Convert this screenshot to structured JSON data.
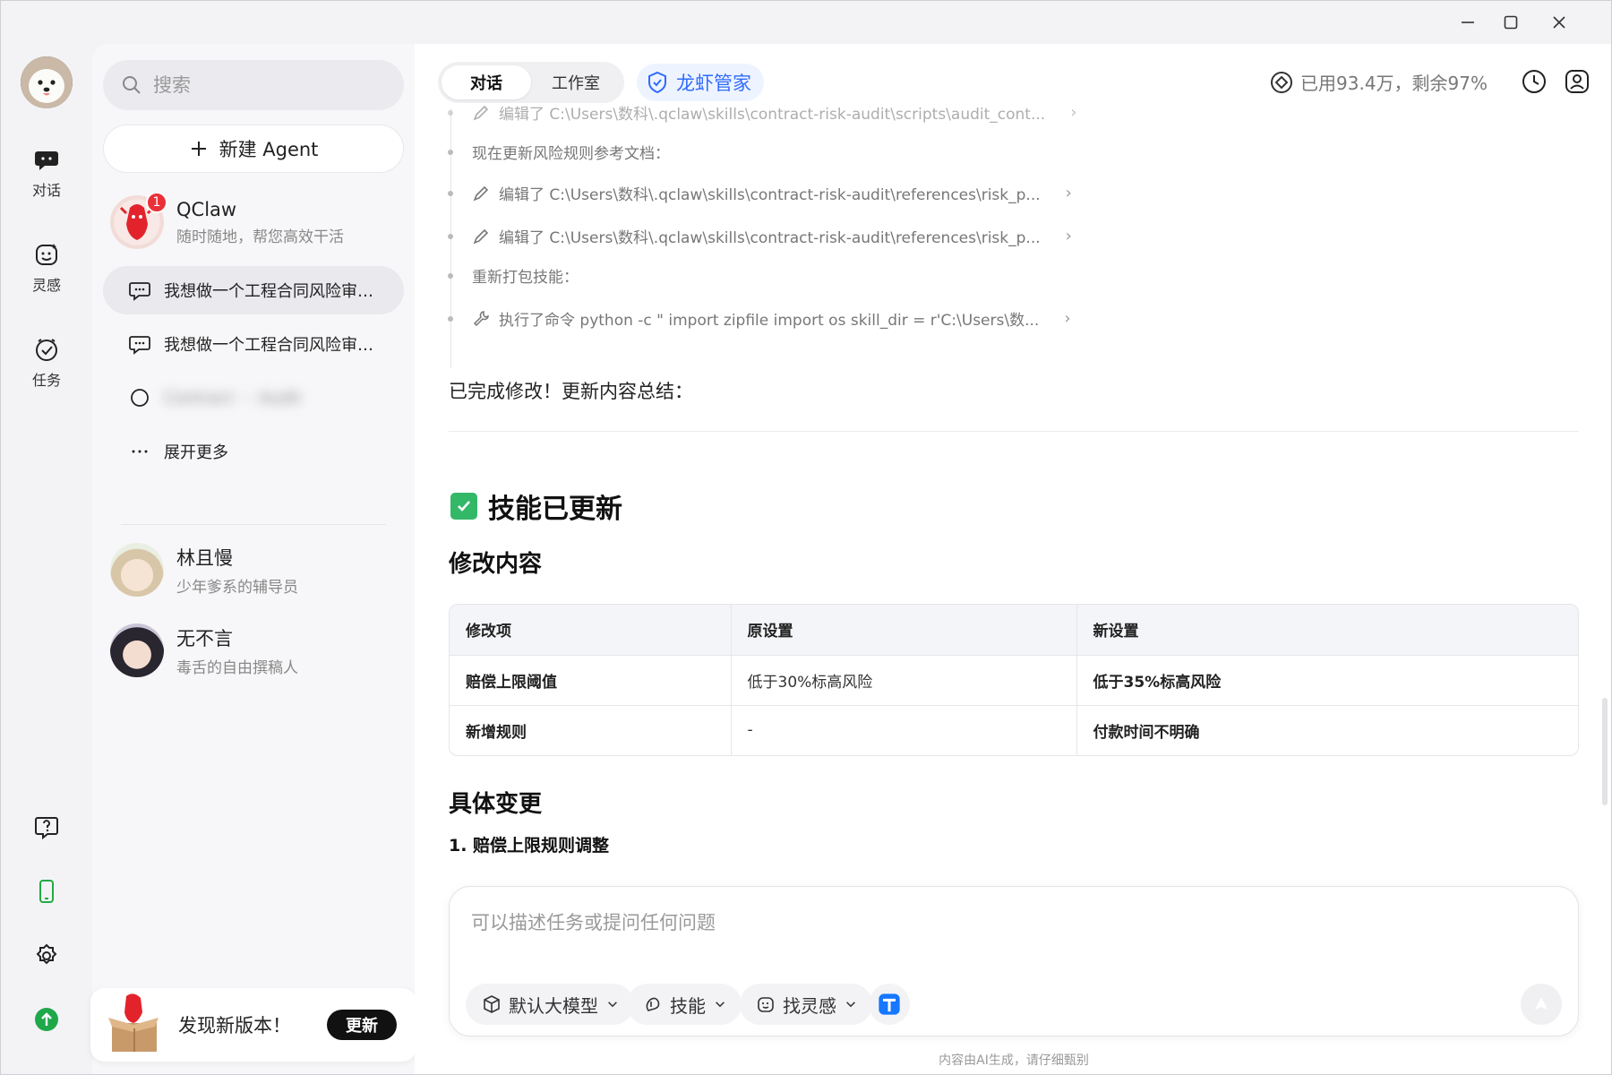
{
  "window": {
    "minimize": "minimize",
    "maximize": "maximize",
    "close": "close"
  },
  "rail": {
    "items": [
      {
        "label": "对话",
        "icon": "chat-bubble-icon"
      },
      {
        "label": "灵感",
        "icon": "inspiration-icon"
      },
      {
        "label": "任务",
        "icon": "task-check-icon"
      }
    ],
    "bottom_icons": [
      "help-icon",
      "phone-icon",
      "settings-icon",
      "upgrade-icon"
    ]
  },
  "sidebar": {
    "search_placeholder": "搜索",
    "new_agent_label": "新建 Agent",
    "agents": [
      {
        "name": "QClaw",
        "desc": "随时随地，帮您高效干活",
        "badge": "1"
      },
      {
        "name": "林且慢",
        "desc": "少年爹系的辅导员"
      },
      {
        "name": "无不言",
        "desc": "毒舌的自由撰稿人"
      }
    ],
    "chats": [
      {
        "title": "我想做一个工程合同风险审…"
      },
      {
        "title": "我想做一个工程合同风险审…"
      },
      {
        "title": "Contract ··· Audit"
      }
    ],
    "expand_more": "展开更多",
    "update": {
      "text": "发现新版本！",
      "button": "更新"
    }
  },
  "header": {
    "tabs": [
      "对话",
      "工作室"
    ],
    "manager_label": "龙虾管家",
    "usage_text": "已用93.4万，剩余97%"
  },
  "steps": [
    {
      "type": "action",
      "icon": "pencil-icon",
      "text": "编辑了 C:\\Users\\数科\\.qclaw\\skills\\contract-risk-audit\\scripts\\audit_cont..."
    },
    {
      "type": "note",
      "text": "现在更新风险规则参考文档："
    },
    {
      "type": "action",
      "icon": "pencil-icon",
      "text": "编辑了 C:\\Users\\数科\\.qclaw\\skills\\contract-risk-audit\\references\\risk_p..."
    },
    {
      "type": "action",
      "icon": "pencil-icon",
      "text": "编辑了 C:\\Users\\数科\\.qclaw\\skills\\contract-risk-audit\\references\\risk_p..."
    },
    {
      "type": "note",
      "text": "重新打包技能："
    },
    {
      "type": "action",
      "icon": "wrench-icon",
      "text": "执行了命令 python -c \" import zipfile import os skill_dir = r'C:\\Users\\数..."
    }
  ],
  "content": {
    "summary": "已完成修改！更新内容总结：",
    "heading_updated": "技能已更新",
    "heading_changes": "修改内容",
    "table": {
      "headers": [
        "修改项",
        "原设置",
        "新设置"
      ],
      "rows": [
        [
          "赔偿上限阈值",
          "低于30%标高风险",
          "低于35%标高风险"
        ],
        [
          "新增规则",
          "-",
          "付款时间不明确"
        ]
      ]
    },
    "heading_details": "具体变更",
    "detail_item": "1. 赔偿上限规则调整"
  },
  "composer": {
    "placeholder": "可以描述任务或提问任何问题",
    "chips": [
      "默认大模型",
      "技能",
      "找灵感"
    ],
    "footnote": "内容由AI生成，请仔细甄别"
  }
}
